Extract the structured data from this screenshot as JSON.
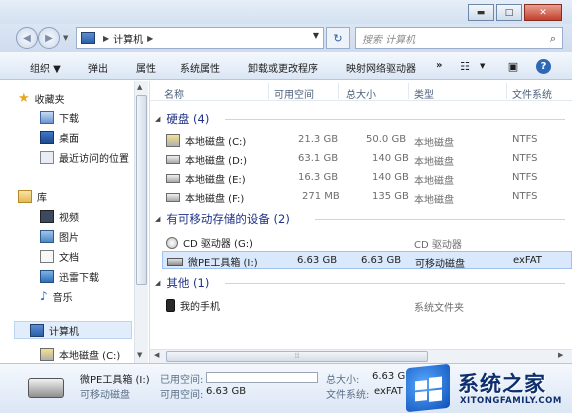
{
  "window": {
    "buttons": {
      "minimize": "▬",
      "maximize": "□",
      "close": "✕"
    }
  },
  "address": {
    "path": "计算机",
    "search_placeholder": "搜索 计算机"
  },
  "toolbar": {
    "organize": "组织 ▼",
    "eject": "弹出",
    "properties": "属性",
    "system_properties": "系统属性",
    "uninstall": "卸载或更改程序",
    "map_drive": "映射网络驱动器",
    "more": "»",
    "help": "?"
  },
  "nav": {
    "favorites": "收藏夹",
    "downloads": "下载",
    "desktop": "桌面",
    "recent": "最近访问的位置",
    "libraries": "库",
    "videos": "视频",
    "pictures": "图片",
    "documents": "文档",
    "xunlei": "迅雷下载",
    "music": "音乐",
    "computer": "计算机",
    "local_c": "本地磁盘 (C:)"
  },
  "columns": {
    "name": "名称",
    "free": "可用空间",
    "total": "总大小",
    "type": "类型",
    "fs": "文件系统"
  },
  "groups": {
    "hdd": "硬盘 (4)",
    "removable": "有可移动存储的设备 (2)",
    "other": "其他 (1)"
  },
  "drives": [
    {
      "name": "本地磁盘 (C:)",
      "free": "21.3 GB",
      "total": "50.0 GB",
      "type": "本地磁盘",
      "fs": "NTFS"
    },
    {
      "name": "本地磁盘 (D:)",
      "free": "63.1 GB",
      "total": "140 GB",
      "type": "本地磁盘",
      "fs": "NTFS"
    },
    {
      "name": "本地磁盘 (E:)",
      "free": "16.3 GB",
      "total": "140 GB",
      "type": "本地磁盘",
      "fs": "NTFS"
    },
    {
      "name": "本地磁盘 (F:)",
      "free": "271 MB",
      "total": "135 GB",
      "type": "本地磁盘",
      "fs": "NTFS"
    }
  ],
  "removable": [
    {
      "name": "CD 驱动器 (G:)",
      "free": "",
      "total": "",
      "type": "CD 驱动器",
      "fs": ""
    },
    {
      "name": "微PE工具箱 (I:)",
      "free": "6.63 GB",
      "total": "6.63 GB",
      "type": "可移动磁盘",
      "fs": "exFAT"
    }
  ],
  "other": [
    {
      "name": "我的手机",
      "type": "系统文件夹"
    }
  ],
  "details": {
    "name": "微PE工具箱 (I:)",
    "type": "可移动磁盘",
    "used_label": "已用空间:",
    "free_label": "可用空间:",
    "free_value": "6.63 GB",
    "total_label": "总大小:",
    "total_value": "6.63 GB",
    "fs_label": "文件系统:",
    "fs_value": "exFAT"
  },
  "watermark": {
    "title": "系统之家",
    "url": "XITONGFAMILY.COM"
  }
}
